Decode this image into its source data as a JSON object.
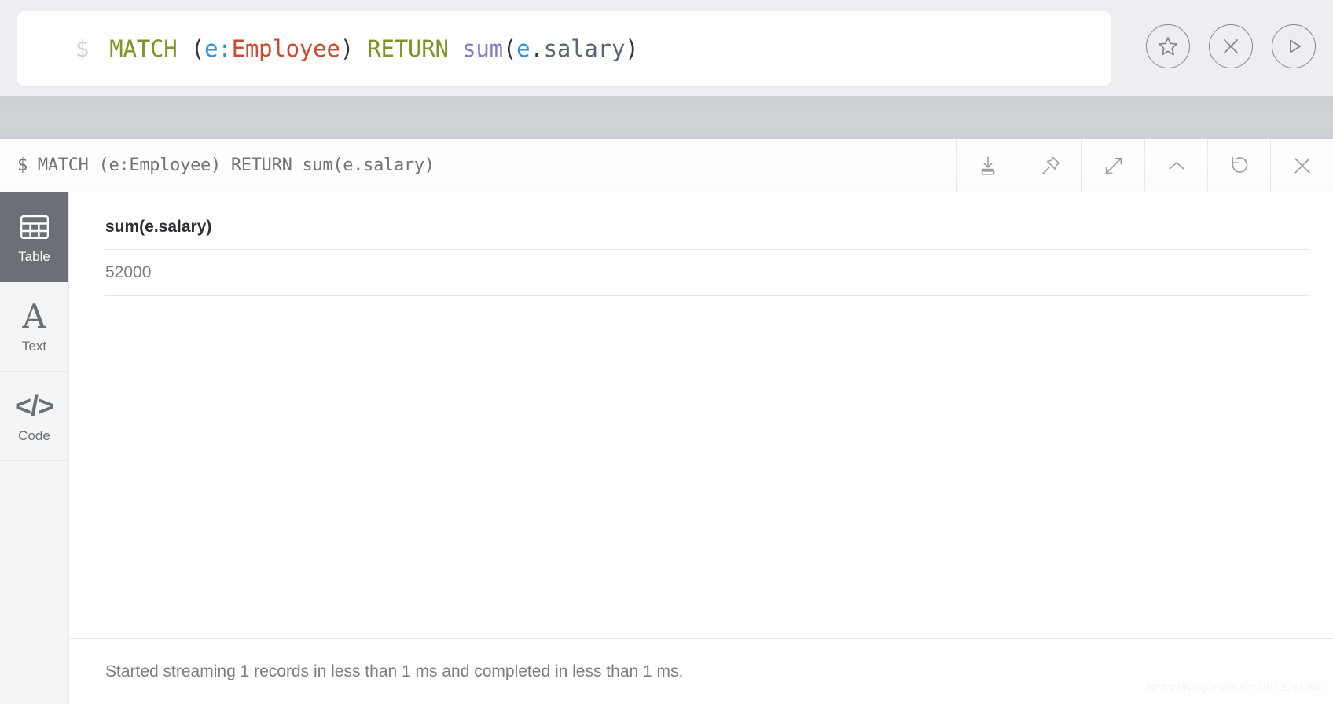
{
  "editor": {
    "prompt": "$",
    "query_tokens": [
      {
        "text": "MATCH ",
        "type": "keyword"
      },
      {
        "text": "(",
        "type": "paren"
      },
      {
        "text": "e",
        "type": "variable"
      },
      {
        "text": ":",
        "type": "colon"
      },
      {
        "text": "Employee",
        "type": "label"
      },
      {
        "text": ")",
        "type": "paren"
      },
      {
        "text": " ",
        "type": "paren"
      },
      {
        "text": "RETURN ",
        "type": "keyword"
      },
      {
        "text": "sum",
        "type": "function"
      },
      {
        "text": "(",
        "type": "paren"
      },
      {
        "text": "e",
        "type": "variable"
      },
      {
        "text": ".",
        "type": "dot"
      },
      {
        "text": "salary",
        "type": "property"
      },
      {
        "text": ")",
        "type": "paren"
      }
    ],
    "query_plain": "MATCH (e:Employee) RETURN sum(e.salary)",
    "actions": [
      {
        "name": "favorite",
        "icon": "star-icon",
        "title": "Favorite"
      },
      {
        "name": "clear",
        "icon": "close-icon",
        "title": "Clear"
      },
      {
        "name": "run",
        "icon": "play-icon",
        "title": "Run"
      }
    ]
  },
  "frame": {
    "prompt": "$",
    "query": "$ MATCH (e:Employee) RETURN sum(e.salary)",
    "tools": [
      {
        "name": "download",
        "icon": "download-icon",
        "title": "Download"
      },
      {
        "name": "pin",
        "icon": "pin-icon",
        "title": "Pin"
      },
      {
        "name": "expand",
        "icon": "expand-icon",
        "title": "Fullscreen"
      },
      {
        "name": "collapse",
        "icon": "chevron-up-icon",
        "title": "Collapse"
      },
      {
        "name": "refresh",
        "icon": "refresh-icon",
        "title": "Rerun"
      },
      {
        "name": "close",
        "icon": "close-icon",
        "title": "Close"
      }
    ]
  },
  "views": [
    {
      "id": "table",
      "label": "Table",
      "icon": "table-icon",
      "active": true
    },
    {
      "id": "text",
      "label": "Text",
      "icon": "letter-a-icon",
      "active": false
    },
    {
      "id": "code",
      "label": "Code",
      "icon": "code-brackets-icon",
      "active": false
    }
  ],
  "result": {
    "columns": [
      "sum(e.salary)"
    ],
    "rows": [
      [
        "52000"
      ]
    ]
  },
  "status": {
    "text": "Started streaming 1 records in less than 1 ms and completed in less than 1 ms."
  },
  "watermark": {
    "text": "https://blog.csdn.net/u013250861"
  },
  "colors": {
    "page_bg": "#eeeef2",
    "band": "#cdd0d5",
    "active_view": "#6b6f76",
    "keyword": "#7d9427",
    "label": "#cb4b32",
    "variable": "#358fd6",
    "function": "#8080c0",
    "property": "#5c6670"
  }
}
